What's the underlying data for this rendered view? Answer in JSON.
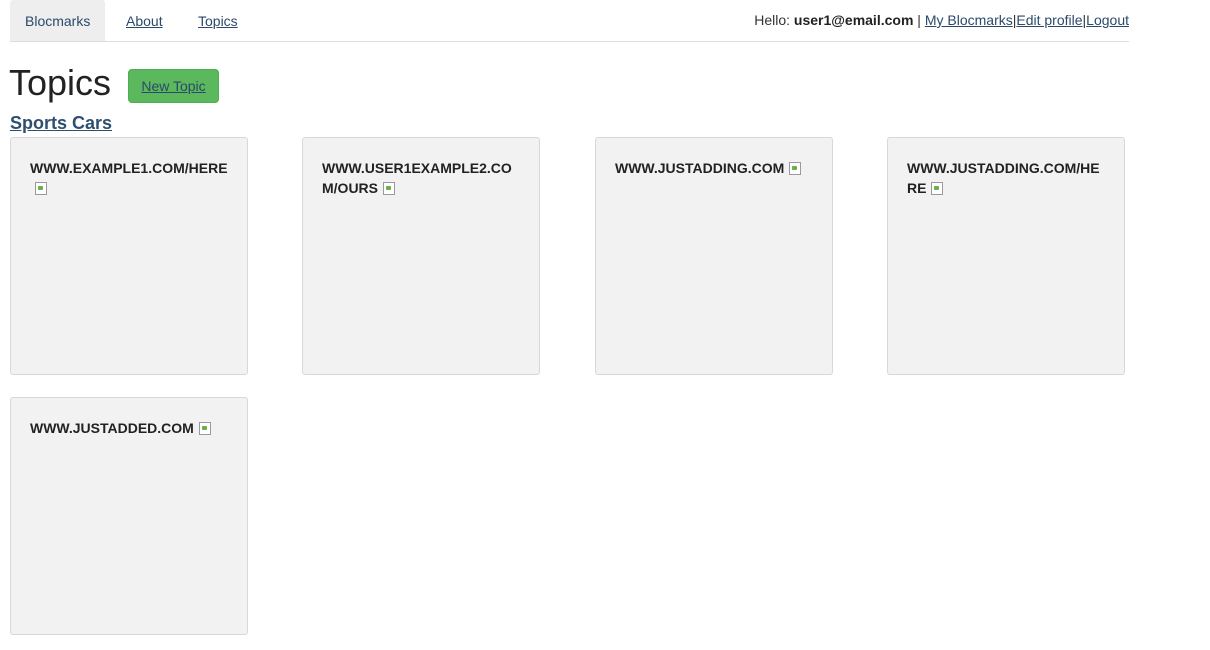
{
  "nav": {
    "tabs": [
      {
        "label": "Blocmarks"
      },
      {
        "label": "About"
      },
      {
        "label": "Topics"
      }
    ]
  },
  "user": {
    "greeting": "Hello:",
    "email": "user1@email.com",
    "separator": "|",
    "links": [
      {
        "label": "My Blocmarks"
      },
      {
        "label": "Edit profile"
      },
      {
        "label": "Logout"
      }
    ]
  },
  "page": {
    "title": "Topics",
    "new_topic_label": "New Topic"
  },
  "topic": {
    "name": "Sports Cars",
    "bookmarks": [
      {
        "url": "www.example1.com/here"
      },
      {
        "url": "www.user1example2.com/ours"
      },
      {
        "url": "www.justadding.com"
      },
      {
        "url": "www.justadding.com/here"
      },
      {
        "url": "www.justadded.com"
      }
    ]
  }
}
